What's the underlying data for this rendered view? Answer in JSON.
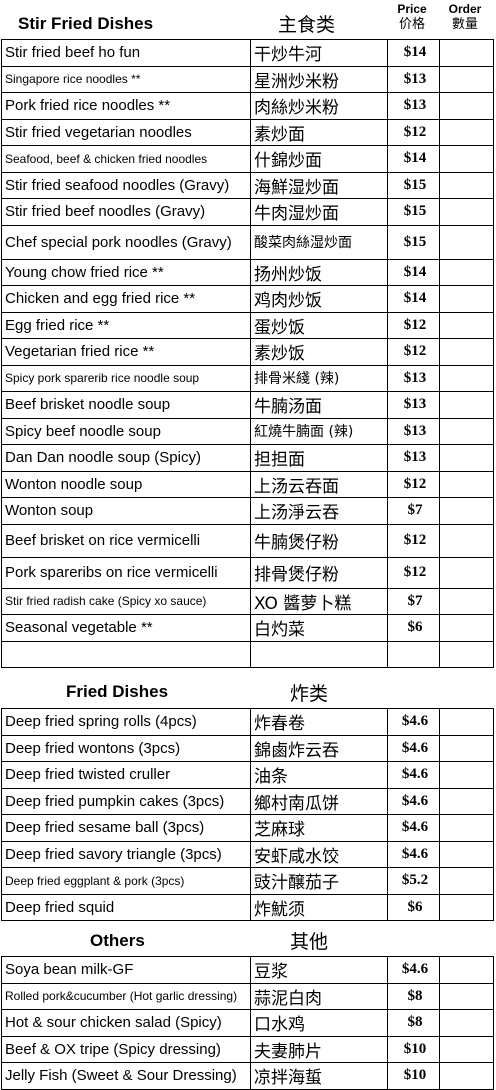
{
  "headers": {
    "price_en": "Price",
    "price_zh": "价格",
    "order_en": "Order",
    "order_zh": "數量"
  },
  "sections": {
    "stir_fried": {
      "title_en": "Stir Fried Dishes",
      "title_zh": "主食类",
      "items": [
        {
          "en": "Stir fried beef ho fun",
          "zh": "干炒牛河",
          "price": "$14"
        },
        {
          "en": "Singapore rice noodles **",
          "zh": "星洲炒米粉",
          "price": "$13"
        },
        {
          "en": "Pork fried rice noodles **",
          "zh": "肉絲炒米粉",
          "price": "$13"
        },
        {
          "en": "Stir fried vegetarian noodles",
          "zh": "素炒面",
          "price": "$12"
        },
        {
          "en": "Seafood, beef & chicken fried noodles",
          "zh": "什錦炒面",
          "price": "$14"
        },
        {
          "en": "Stir fried seafood noodles (Gravy)",
          "zh": "海鮮湿炒面",
          "price": "$15"
        },
        {
          "en": "Stir fried beef noodles (Gravy)",
          "zh": "牛肉湿炒面",
          "price": "$15"
        },
        {
          "en": "Chef special pork noodles (Gravy)",
          "zh": "酸菜肉絲湿炒面",
          "price": "$15"
        },
        {
          "en": "Young chow fried rice **",
          "zh": "扬州炒饭",
          "price": "$14"
        },
        {
          "en": "Chicken and egg fried rice **",
          "zh": "鸡肉炒饭",
          "price": "$14"
        },
        {
          "en": "Egg fried rice **",
          "zh": "蛋炒饭",
          "price": "$12"
        },
        {
          "en": "Vegetarian fried rice **",
          "zh": "素炒饭",
          "price": "$12"
        },
        {
          "en": "Spicy pork sparerib rice noodle soup",
          "zh": "排骨米綫 (辣)",
          "price": "$13"
        },
        {
          "en": "Beef brisket noodle soup",
          "zh": "牛腩汤面",
          "price": "$13"
        },
        {
          "en": "Spicy beef noodle soup",
          "zh": "紅燒牛腩面 (辣)",
          "price": "$13"
        },
        {
          "en": "Dan Dan noodle soup (Spicy)",
          "zh": "担担面",
          "price": "$13"
        },
        {
          "en": "Wonton noodle soup",
          "zh": "上汤云吞面",
          "price": "$12"
        },
        {
          "en": "Wonton soup",
          "zh": "上汤淨云吞",
          "price": "$7"
        },
        {
          "en": "Beef brisket on rice vermicelli",
          "zh": "牛腩煲仔粉",
          "price": "$12"
        },
        {
          "en": "Pork spareribs on rice vermicelli",
          "zh": "排骨煲仔粉",
          "price": "$12"
        },
        {
          "en": "Stir fried radish cake (Spicy xo sauce)",
          "zh": "XO 醬萝卜糕",
          "price": "$7"
        },
        {
          "en": "Seasonal vegetable **",
          "zh": "白灼菜",
          "price": "$6"
        },
        {
          "en": "",
          "zh": "",
          "price": ""
        }
      ]
    },
    "fried": {
      "title_en": "Fried Dishes",
      "title_zh": "炸类",
      "items": [
        {
          "en": "Deep fried spring rolls (4pcs)",
          "zh": "炸春卷",
          "price": "$4.6"
        },
        {
          "en": "Deep fried wontons (3pcs)",
          "zh": "錦鹵炸云吞",
          "price": "$4.6"
        },
        {
          "en": "Deep fried twisted cruller",
          "zh": "油条",
          "price": "$4.6"
        },
        {
          "en": "Deep fried pumpkin cakes (3pcs)",
          "zh": "鄉村南瓜饼",
          "price": "$4.6"
        },
        {
          "en": "Deep fried sesame ball (3pcs)",
          "zh": "芝麻球",
          "price": "$4.6"
        },
        {
          "en": "Deep fried savory triangle (3pcs)",
          "zh": "安虾咸水饺",
          "price": "$4.6"
        },
        {
          "en": "Deep fried eggplant & pork (3pcs)",
          "zh": "豉汁醸茄子",
          "price": "$5.2"
        },
        {
          "en": "Deep fried squid",
          "zh": "炸魷须",
          "price": "$6"
        }
      ]
    },
    "others": {
      "title_en": "Others",
      "title_zh": "其他",
      "items": [
        {
          "en": "Soya bean milk-GF",
          "zh": "豆浆",
          "price": "$4.6"
        },
        {
          "en": "Rolled pork&cucumber (Hot garlic dressing)",
          "zh": "蒜泥白肉",
          "price": "$8"
        },
        {
          "en": "Hot & sour chicken salad (Spicy)",
          "zh": "口水鸡",
          "price": "$8"
        },
        {
          "en": "Beef & OX tripe (Spicy dressing)",
          "zh": "夫妻肺片",
          "price": "$10"
        },
        {
          "en": "Jelly Fish (Sweet & Sour Dressing)",
          "zh": "凉拌海蜇",
          "price": "$10"
        }
      ]
    }
  }
}
